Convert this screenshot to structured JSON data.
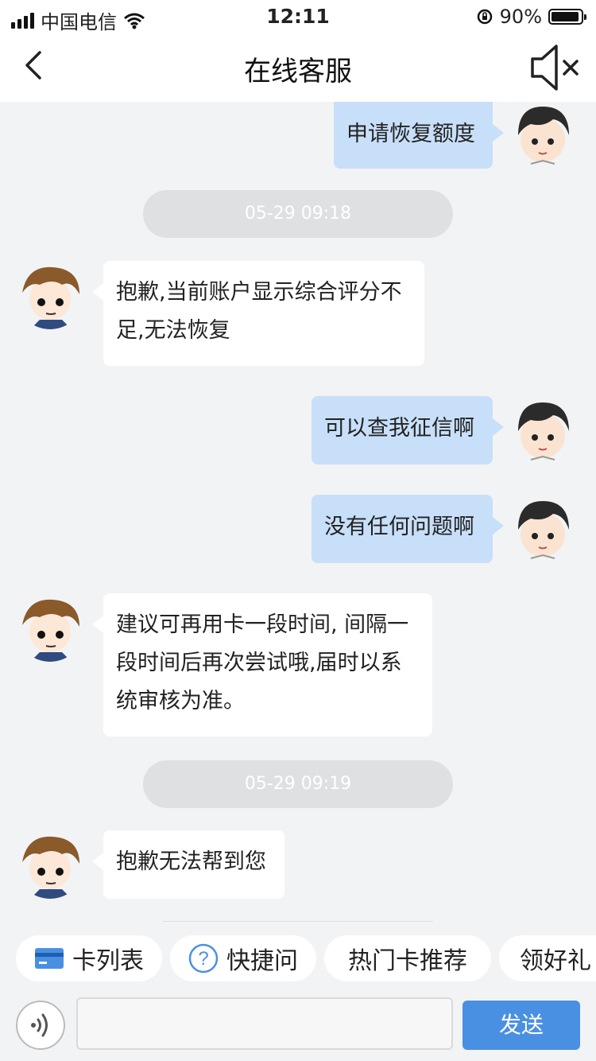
{
  "status_bar": {
    "carrier": "中国电信",
    "time": "12:11",
    "battery_percent": "90%"
  },
  "nav": {
    "title": "在线客服"
  },
  "chat": {
    "messages": [
      {
        "from": "user",
        "text": "申请恢复额度"
      },
      {
        "type": "time",
        "text": "05-29 09:18"
      },
      {
        "from": "agent",
        "text": "抱歉,当前账户显示综合评分不足,无法恢复"
      },
      {
        "from": "user",
        "text": "可以查我征信啊"
      },
      {
        "from": "user",
        "text": "没有任何问题啊"
      },
      {
        "from": "agent",
        "text": "建议可再用卡一段时间, 间隔一段时间后再次尝试哦,届时以系统审核为准。"
      },
      {
        "type": "time",
        "text": "05-29 09:19"
      },
      {
        "from": "agent",
        "text": "抱歉无法帮到您"
      }
    ]
  },
  "quick_actions": [
    {
      "label": "卡列表",
      "icon": "card-icon"
    },
    {
      "label": "快捷问",
      "icon": "question-icon"
    },
    {
      "label": "热门卡推荐"
    },
    {
      "label": "领好礼"
    }
  ],
  "input": {
    "value": "",
    "send_label": "发送"
  },
  "colors": {
    "user_bubble": "#c8dff9",
    "send_button": "#4a90e2",
    "background": "#f2f3f4"
  }
}
